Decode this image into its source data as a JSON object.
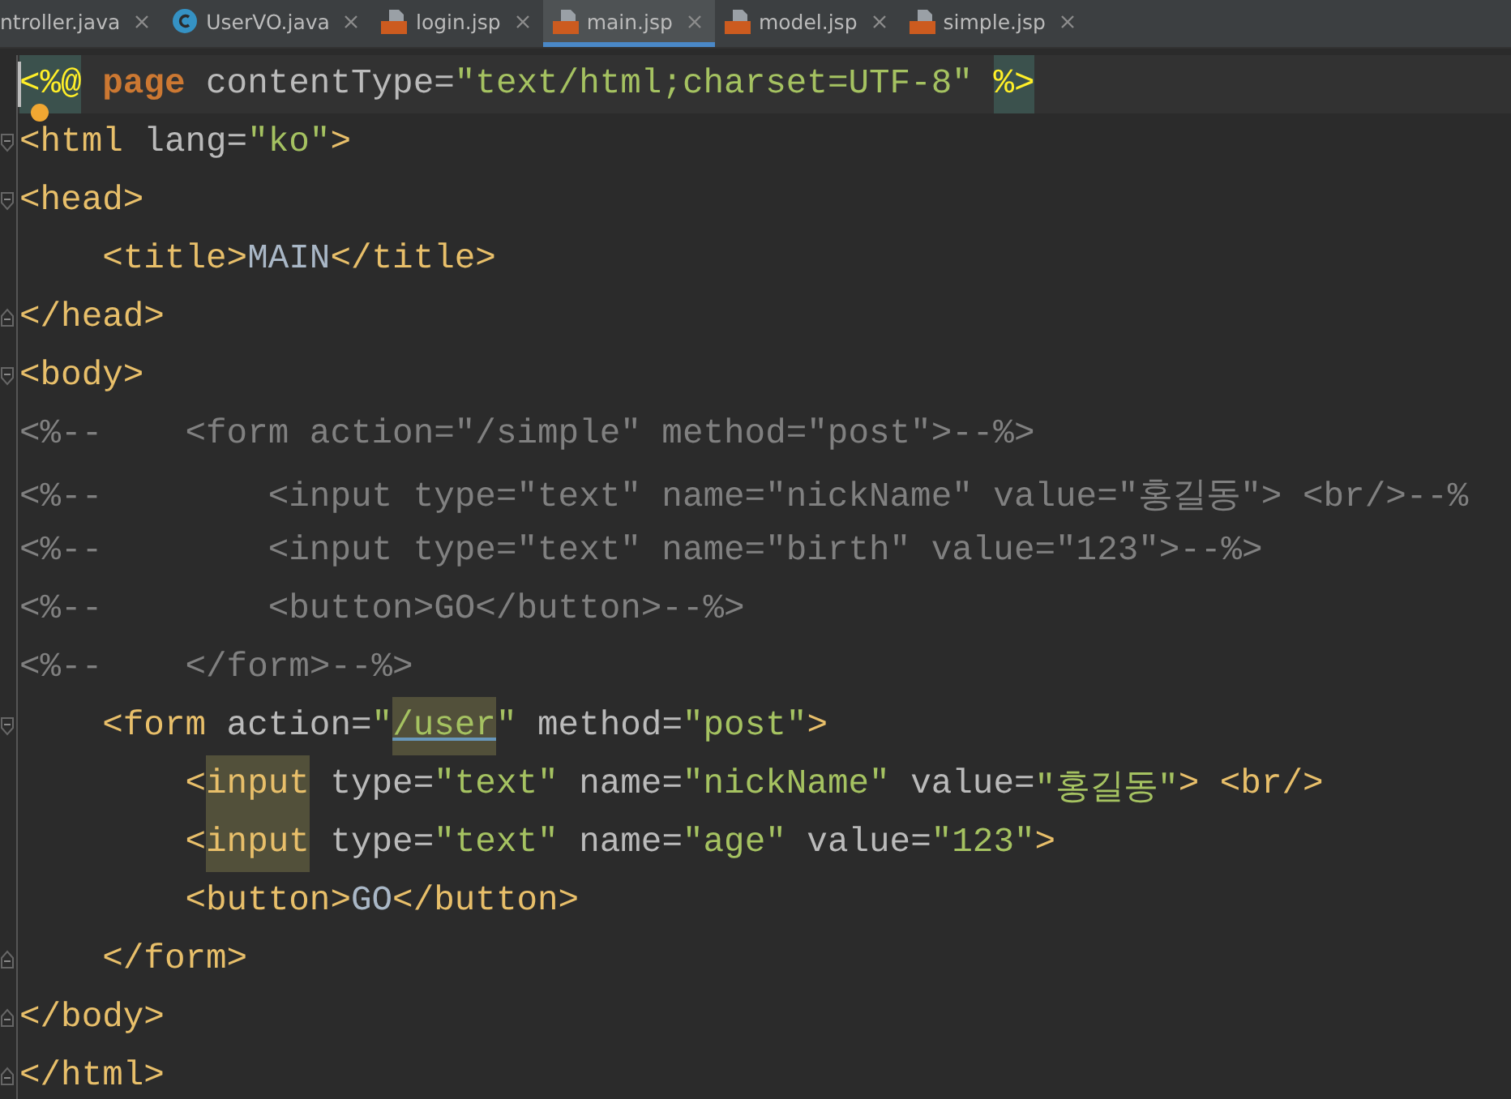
{
  "tabs": [
    {
      "label": "ntroller.java",
      "kind": "plain",
      "selected": false
    },
    {
      "label": "UserVO.java",
      "kind": "class",
      "selected": false
    },
    {
      "label": "login.jsp",
      "kind": "jsp",
      "selected": false
    },
    {
      "label": "main.jsp",
      "kind": "jsp",
      "selected": true
    },
    {
      "label": "model.jsp",
      "kind": "jsp",
      "selected": false
    },
    {
      "label": "simple.jsp",
      "kind": "jsp",
      "selected": false
    }
  ],
  "lines": [
    {
      "current": true,
      "caret": true,
      "hint": true,
      "kind": "code",
      "tokens": [
        {
          "kind": "directive",
          "text": "<%@",
          "highlight": true
        },
        {
          "kind": "keyword",
          "text": " page"
        },
        {
          "kind": "attr",
          "text": " contentType="
        },
        {
          "kind": "string",
          "text": "\"text/html;charset=UTF-8\" "
        },
        {
          "kind": "directive",
          "text": "%>",
          "highlight": true
        }
      ]
    },
    {
      "kind": "fold-start",
      "tokens": [
        {
          "kind": "tag",
          "text": "<html"
        },
        {
          "kind": "attr",
          "text": " lang="
        },
        {
          "kind": "string",
          "text": "\"ko\""
        },
        {
          "kind": "tag",
          "text": ">"
        }
      ]
    },
    {
      "kind": "fold-start",
      "tokens": [
        {
          "kind": "tag",
          "text": "<head>"
        }
      ]
    },
    {
      "kind": "code",
      "tokens": [
        {
          "kind": "tag",
          "text": "    <title>"
        },
        {
          "kind": "plain",
          "text": "MAIN"
        },
        {
          "kind": "tag",
          "text": "</title>"
        }
      ]
    },
    {
      "kind": "fold-end",
      "tokens": [
        {
          "kind": "tag",
          "text": "</head>"
        }
      ]
    },
    {
      "kind": "fold-start",
      "tokens": [
        {
          "kind": "tag",
          "text": "<body>"
        }
      ]
    },
    {
      "kind": "code",
      "tokens": [
        {
          "kind": "comment",
          "text": "<%--    <form action=\"/simple\" method=\"post\">--%>"
        }
      ]
    },
    {
      "kind": "code",
      "tokens": [
        {
          "kind": "comment",
          "text": "<%--        <input type=\"text\" name=\"nickName\" value=\"홍길동\"> <br/>--%"
        }
      ]
    },
    {
      "kind": "code",
      "tokens": [
        {
          "kind": "comment",
          "text": "<%--        <input type=\"text\" name=\"birth\" value=\"123\">--%>"
        }
      ]
    },
    {
      "kind": "code",
      "tokens": [
        {
          "kind": "comment",
          "text": "<%--        <button>GO</button>--%>"
        }
      ]
    },
    {
      "kind": "code",
      "tokens": [
        {
          "kind": "comment",
          "text": "<%--    </form>--%>"
        }
      ]
    },
    {
      "kind": "fold-start",
      "tokens": [
        {
          "kind": "tag",
          "text": "    <form"
        },
        {
          "kind": "attr",
          "text": " action="
        },
        {
          "kind": "string",
          "text": "\""
        },
        {
          "kind": "string",
          "text": "/user",
          "highlight": true
        },
        {
          "kind": "string",
          "text": "\""
        },
        {
          "kind": "attr",
          "text": " method="
        },
        {
          "kind": "string",
          "text": "\"post\""
        },
        {
          "kind": "tag",
          "text": ">"
        }
      ]
    },
    {
      "kind": "code",
      "tokens": [
        {
          "kind": "tag",
          "text": "        <"
        },
        {
          "kind": "tag",
          "text": "input",
          "highlight": true
        },
        {
          "kind": "attr",
          "text": " type="
        },
        {
          "kind": "string",
          "text": "\"text\""
        },
        {
          "kind": "attr",
          "text": " name="
        },
        {
          "kind": "string",
          "text": "\"nickName\""
        },
        {
          "kind": "attr",
          "text": " value="
        },
        {
          "kind": "string",
          "text": "\"홍길동\""
        },
        {
          "kind": "tag",
          "text": "> <br/>"
        }
      ]
    },
    {
      "kind": "code",
      "tokens": [
        {
          "kind": "tag",
          "text": "        <"
        },
        {
          "kind": "tag",
          "text": "input",
          "highlight": true
        },
        {
          "kind": "attr",
          "text": " type="
        },
        {
          "kind": "string",
          "text": "\"text\""
        },
        {
          "kind": "attr",
          "text": " name="
        },
        {
          "kind": "string",
          "text": "\"age\""
        },
        {
          "kind": "attr",
          "text": " value="
        },
        {
          "kind": "string",
          "text": "\"123\""
        },
        {
          "kind": "tag",
          "text": ">"
        }
      ]
    },
    {
      "kind": "code",
      "tokens": [
        {
          "kind": "tag",
          "text": "        <button>"
        },
        {
          "kind": "plain",
          "text": "GO"
        },
        {
          "kind": "tag",
          "text": "</button>"
        }
      ]
    },
    {
      "kind": "fold-end",
      "tokens": [
        {
          "kind": "tag",
          "text": "    </form>"
        }
      ]
    },
    {
      "kind": "fold-end",
      "tokens": [
        {
          "kind": "tag",
          "text": "</body>"
        }
      ]
    },
    {
      "kind": "fold-end",
      "tokens": [
        {
          "kind": "tag",
          "text": "</html>"
        }
      ]
    }
  ]
}
